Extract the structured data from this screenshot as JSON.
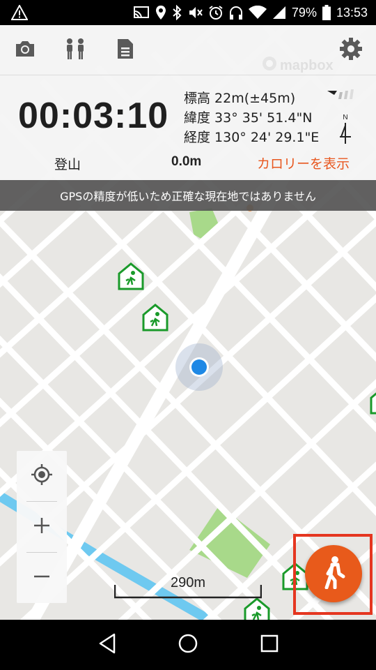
{
  "status_bar": {
    "battery": "79%",
    "time": "13:53",
    "icons": [
      "warning-icon",
      "cast-icon",
      "location-icon",
      "bluetooth-icon",
      "vibrate-off-icon",
      "alarm-icon",
      "headphones-icon",
      "wifi-icon",
      "signal-icon",
      "battery-icon"
    ]
  },
  "toolbar": {
    "icons": [
      "camera-icon",
      "people-icon",
      "document-icon",
      "settings-icon"
    ]
  },
  "tracking": {
    "elapsed": "00:03:10",
    "altitude_label": "標高",
    "altitude_value": "22m(±45m)",
    "latitude_label": "緯度",
    "latitude_value": "33° 35' 51.4\"N",
    "longitude_label": "経度",
    "longitude_value": "130° 24' 29.1\"E",
    "compass_label": "N",
    "activity_mode": "登山",
    "distance": "0.0m",
    "calorie_button": "カロリーを表示"
  },
  "banner": {
    "message": "GPSの精度が低いため正確な現在地ではありません"
  },
  "map": {
    "attribution": "mapbox",
    "scale_label": "290m",
    "colors": {
      "background": "#e8e7e4",
      "road": "#ffffff",
      "park": "#a8d98a",
      "river": "#6ec9f0",
      "location_dot": "#1e88e5",
      "shelter_icon": "#1a9a2a"
    }
  },
  "fab": {
    "icon": "walking-person-icon",
    "color": "#e85a1b",
    "highlight_color": "#e53620"
  },
  "nav_bar": {
    "icons": [
      "back-icon",
      "home-icon",
      "recents-icon"
    ]
  }
}
